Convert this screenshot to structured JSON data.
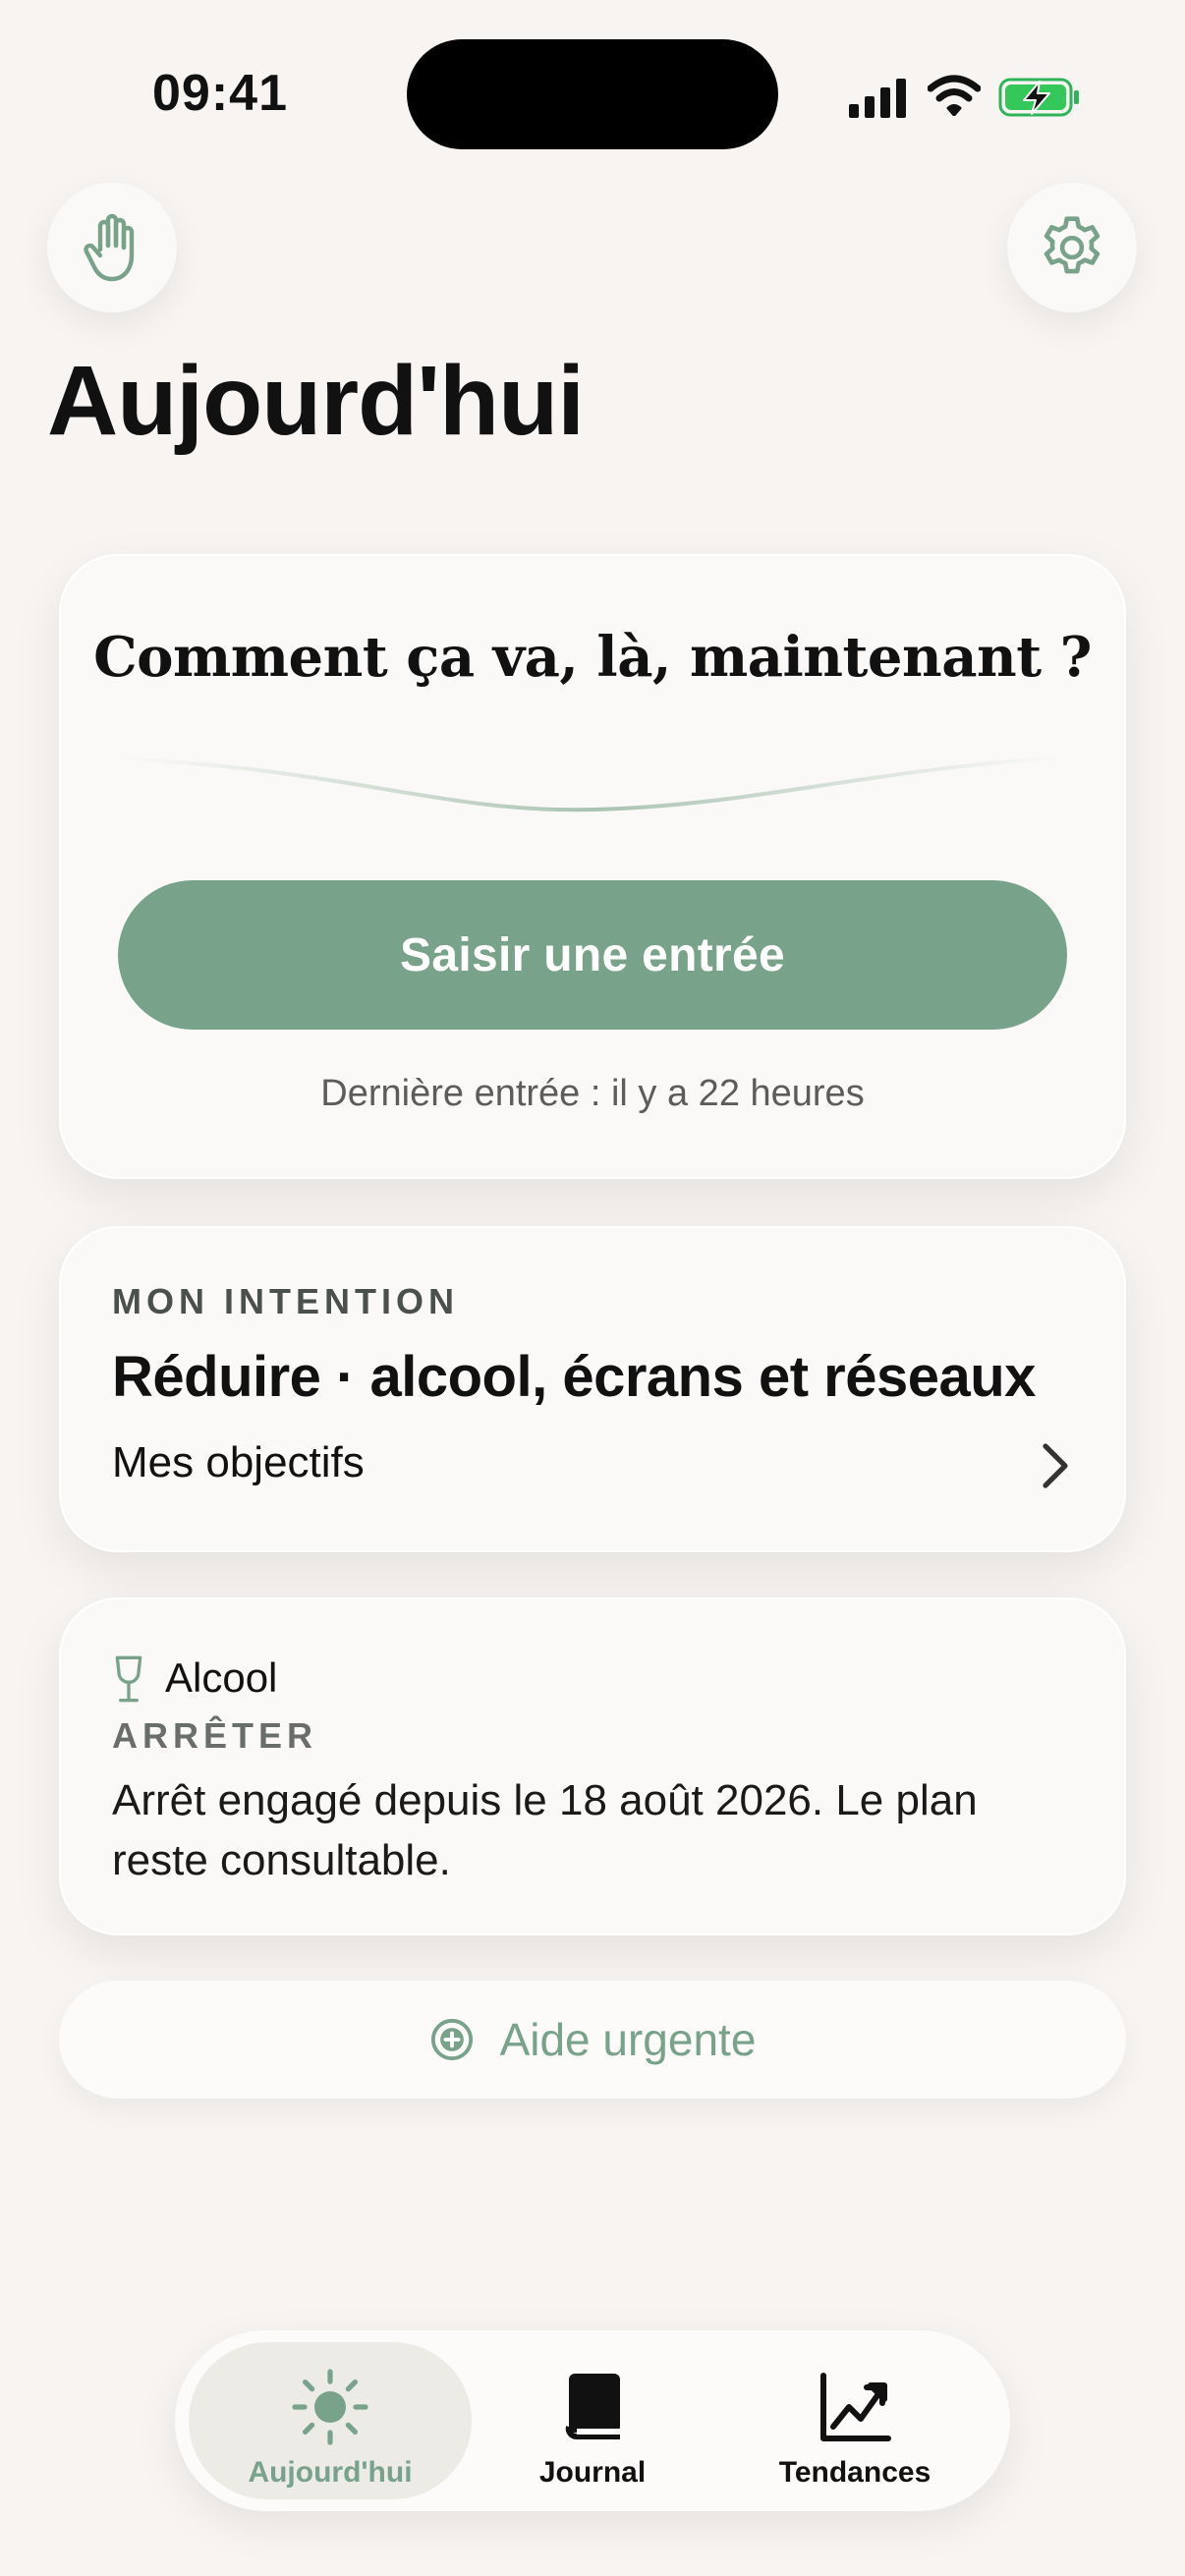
{
  "status_bar": {
    "time": "09:41"
  },
  "header": {
    "title": "Aujourd'hui"
  },
  "mood_card": {
    "question": "Comment ça va, là, maintenant ?",
    "entry_button": "Saisir une entrée",
    "last_entry": "Dernière entrée : il y a 22 heures"
  },
  "intention_card": {
    "eyebrow": "MON INTENTION",
    "title": "Réduire · alcool, écrans et réseaux",
    "link": "Mes objectifs"
  },
  "alcool_card": {
    "label": "Alcool",
    "status": "ARRÊTER",
    "description": "Arrêt engagé depuis le 18 août 2026. Le plan reste consultable."
  },
  "urgent_button": {
    "label": "Aide urgente"
  },
  "tabs": [
    {
      "label": "Aujourd'hui",
      "icon": "sun-icon",
      "active": true
    },
    {
      "label": "Journal",
      "icon": "book-icon",
      "active": false
    },
    {
      "label": "Tendances",
      "icon": "chart-icon",
      "active": false
    }
  ],
  "colors": {
    "accent": "#78a28a",
    "background": "#f7f4f2",
    "card": "#fbf9f7"
  }
}
